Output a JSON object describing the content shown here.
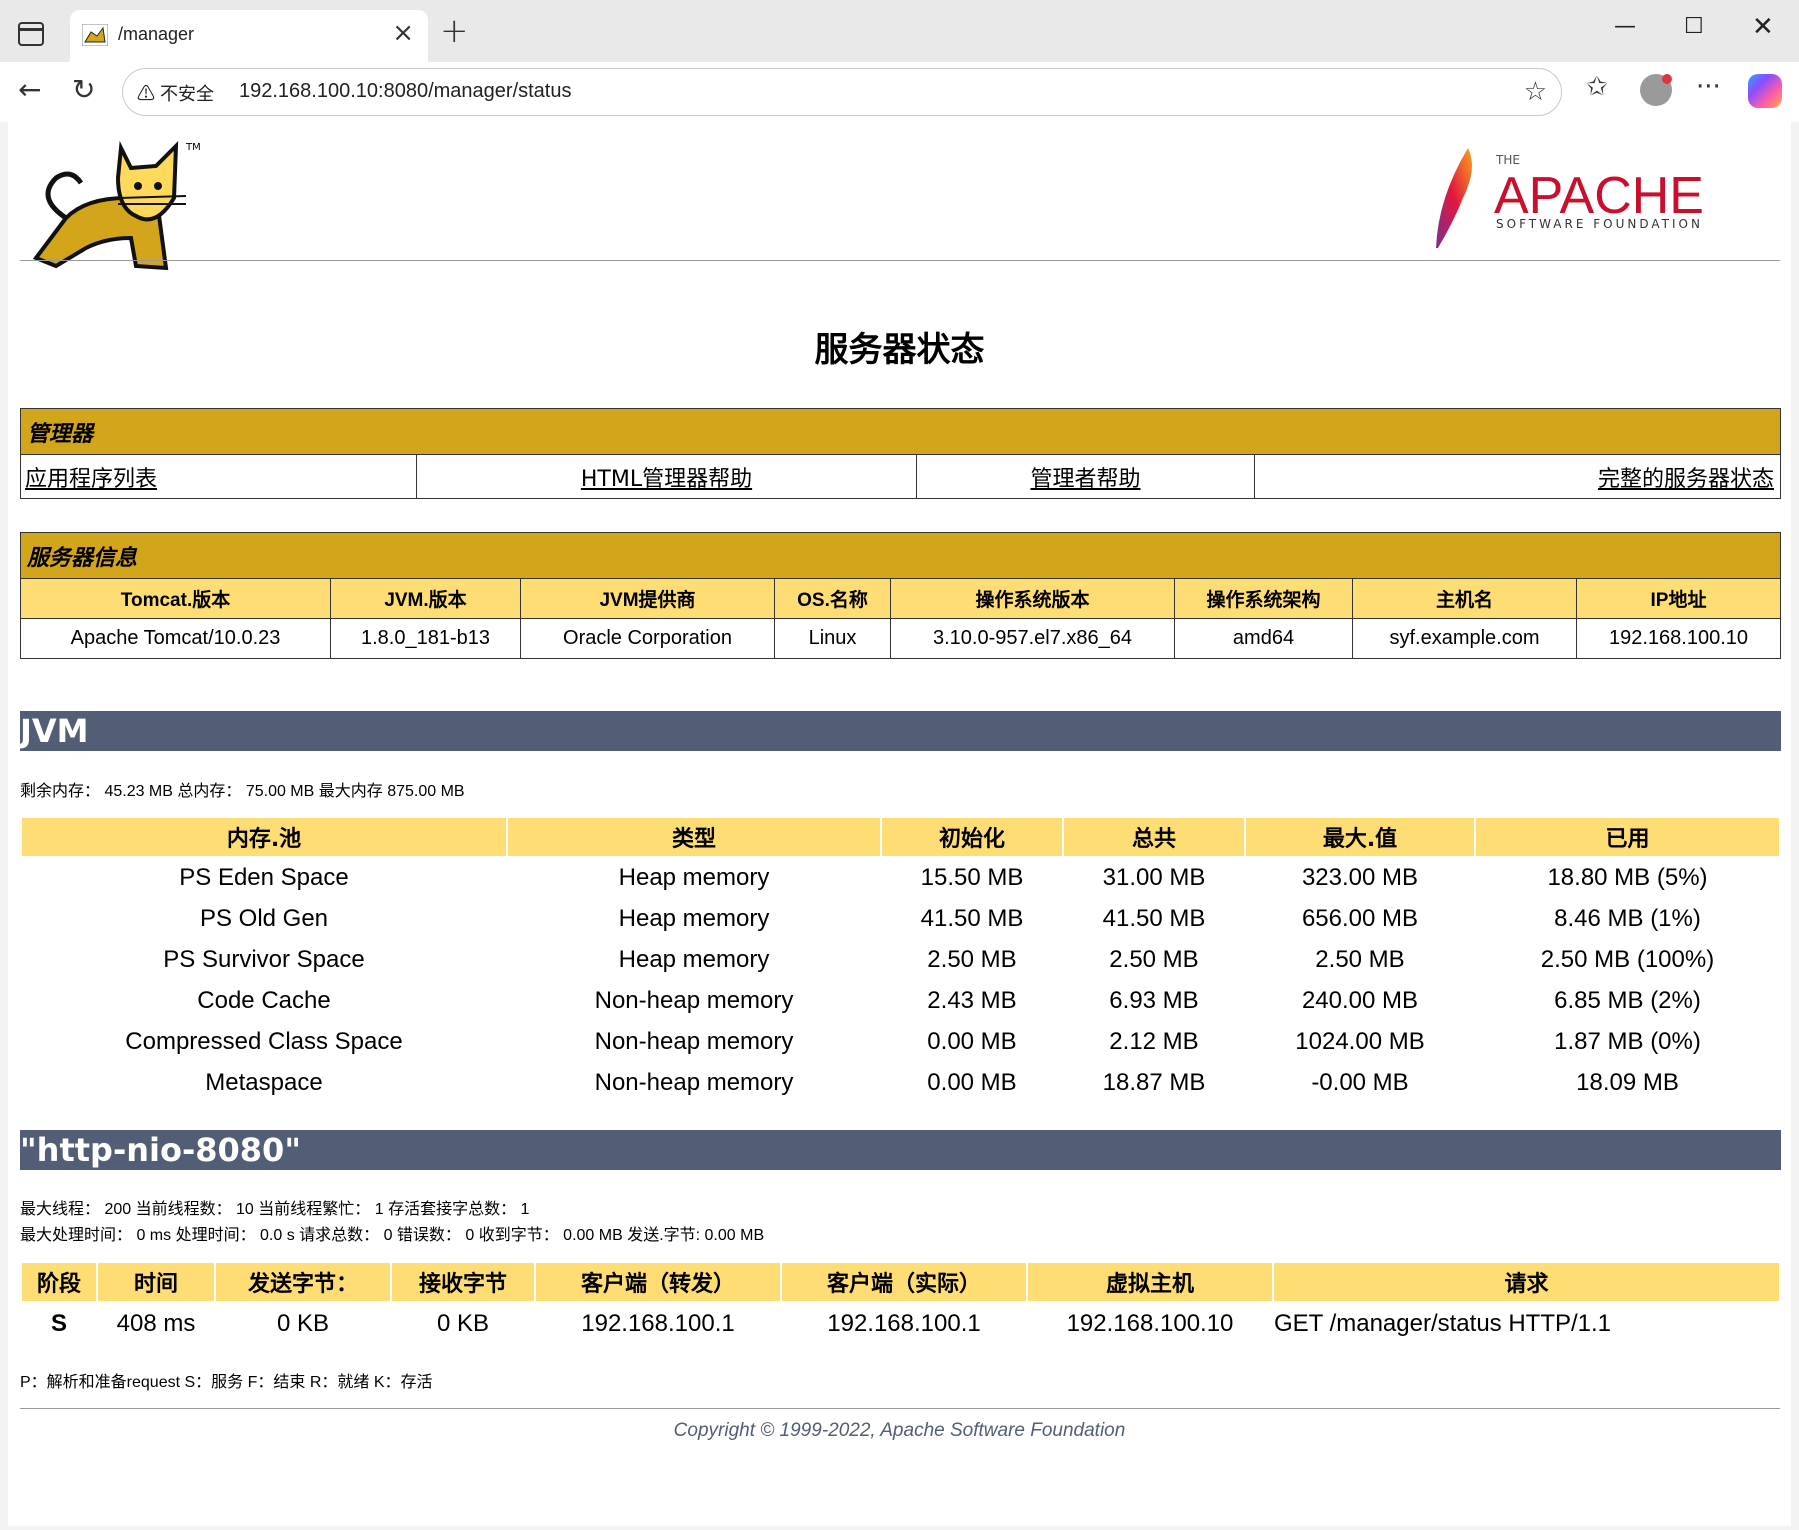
{
  "browser": {
    "tab_title": "/manager",
    "url_warning": "不安全",
    "url": "192.168.100.10:8080/manager/status"
  },
  "logos": {
    "apache_the": "THE",
    "apache_name": "APACHE",
    "apache_sub": "SOFTWARE FOUNDATION"
  },
  "page_title": "服务器状态",
  "manager": {
    "header": "管理器",
    "links": [
      "应用程序列表",
      "HTML管理器帮助",
      "管理者帮助",
      "完整的服务器状态"
    ]
  },
  "server_info": {
    "header": "服务器信息",
    "columns": [
      "Tomcat.版本",
      "JVM.版本",
      "JVM提供商",
      "OS.名称",
      "操作系统版本",
      "操作系统架构",
      "主机名",
      "IP地址"
    ],
    "values": [
      "Apache Tomcat/10.0.23",
      "1.8.0_181-b13",
      "Oracle Corporation",
      "Linux",
      "3.10.0-957.el7.x86_64",
      "amd64",
      "syf.example.com",
      "192.168.100.10"
    ]
  },
  "jvm": {
    "title": "JVM",
    "memory_summary": "剩余内存： 45.23 MB 总内存： 75.00 MB 最大内存 875.00 MB",
    "columns": [
      "内存.池",
      "类型",
      "初始化",
      "总共",
      "最大.值",
      "已用"
    ],
    "rows": [
      [
        "PS Eden Space",
        "Heap memory",
        "15.50 MB",
        "31.00 MB",
        "323.00 MB",
        "18.80 MB (5%)"
      ],
      [
        "PS Old Gen",
        "Heap memory",
        "41.50 MB",
        "41.50 MB",
        "656.00 MB",
        "8.46 MB (1%)"
      ],
      [
        "PS Survivor Space",
        "Heap memory",
        "2.50 MB",
        "2.50 MB",
        "2.50 MB",
        "2.50 MB (100%)"
      ],
      [
        "Code Cache",
        "Non-heap memory",
        "2.43 MB",
        "6.93 MB",
        "240.00 MB",
        "6.85 MB (2%)"
      ],
      [
        "Compressed Class Space",
        "Non-heap memory",
        "0.00 MB",
        "2.12 MB",
        "1024.00 MB",
        "1.87 MB (0%)"
      ],
      [
        "Metaspace",
        "Non-heap memory",
        "0.00 MB",
        "18.87 MB",
        "-0.00 MB",
        "18.09 MB"
      ]
    ]
  },
  "connector": {
    "title": "\"http-nio-8080\"",
    "line1": "最大线程： 200 当前线程数： 10 当前线程繁忙： 1 存活套接字总数： 1",
    "line2": "最大处理时间： 0 ms 处理时间： 0.0 s 请求总数： 0 错误数： 0 收到字节： 0.00 MB 发送.字节: 0.00 MB",
    "columns": [
      "阶段",
      "时间",
      "发送字节：",
      "接收字节",
      "客户端（转发）",
      "客户端（实际）",
      "虚拟主机",
      "请求"
    ],
    "rows": [
      [
        "S",
        "408 ms",
        "0 KB",
        "0 KB",
        "192.168.100.1",
        "192.168.100.1",
        "192.168.100.10",
        "GET /manager/status HTTP/1.1"
      ]
    ],
    "legend": "P：解析和准备request S：服务 F：结束 R：就绪 K：存活"
  },
  "footer": "Copyright © 1999-2022, Apache Software Foundation"
}
